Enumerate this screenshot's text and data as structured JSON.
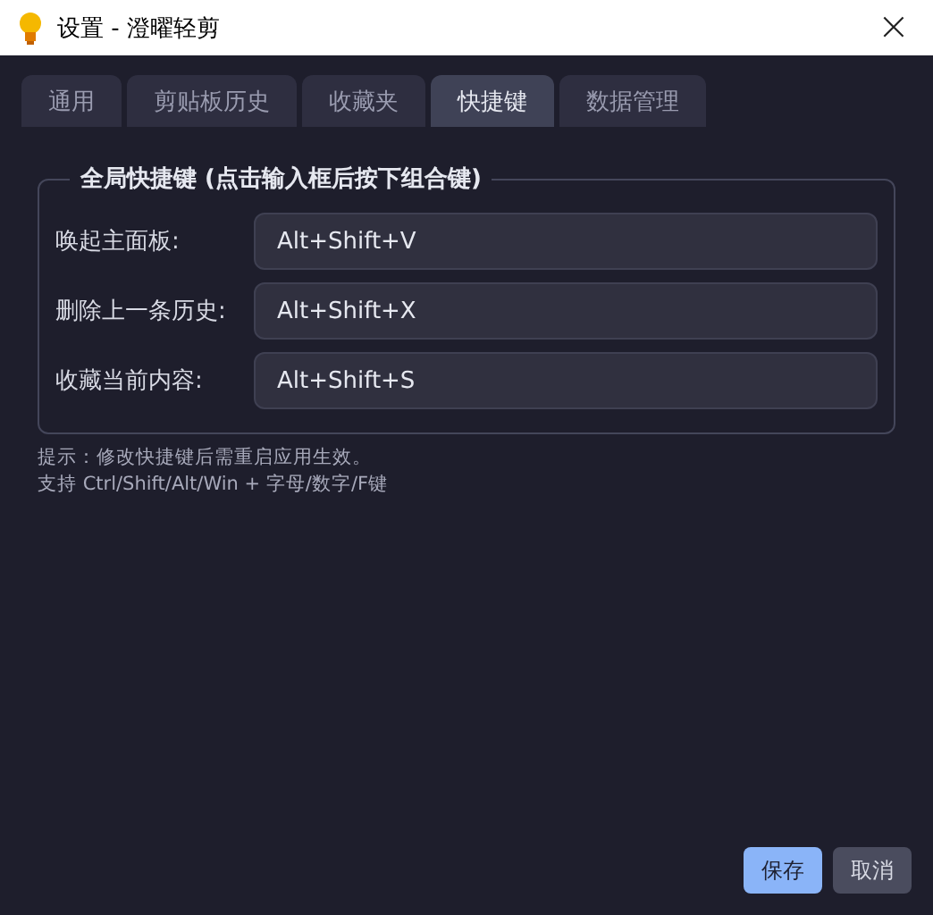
{
  "window": {
    "title": "设置 - 澄曜轻剪",
    "close": "×"
  },
  "tabs": [
    {
      "label": "通用",
      "selected": false
    },
    {
      "label": "剪贴板历史",
      "selected": false
    },
    {
      "label": "收藏夹",
      "selected": false
    },
    {
      "label": "快捷键",
      "selected": true
    },
    {
      "label": "数据管理",
      "selected": false
    }
  ],
  "group": {
    "title": "全局快捷键 (点击输入框后按下组合键)",
    "rows": [
      {
        "label": "唤起主面板:",
        "value": "Alt+Shift+V"
      },
      {
        "label": "删除上一条历史:",
        "value": "Alt+Shift+X"
      },
      {
        "label": "收藏当前内容:",
        "value": "Alt+Shift+S"
      }
    ]
  },
  "hints": [
    "提示：修改快捷键后需重启应用生效。",
    "支持 Ctrl/Shift/Alt/Win + 字母/数字/F键"
  ],
  "buttons": [
    {
      "label": "保存",
      "kind": "primary"
    },
    {
      "label": "取消",
      "kind": "secondary"
    }
  ]
}
